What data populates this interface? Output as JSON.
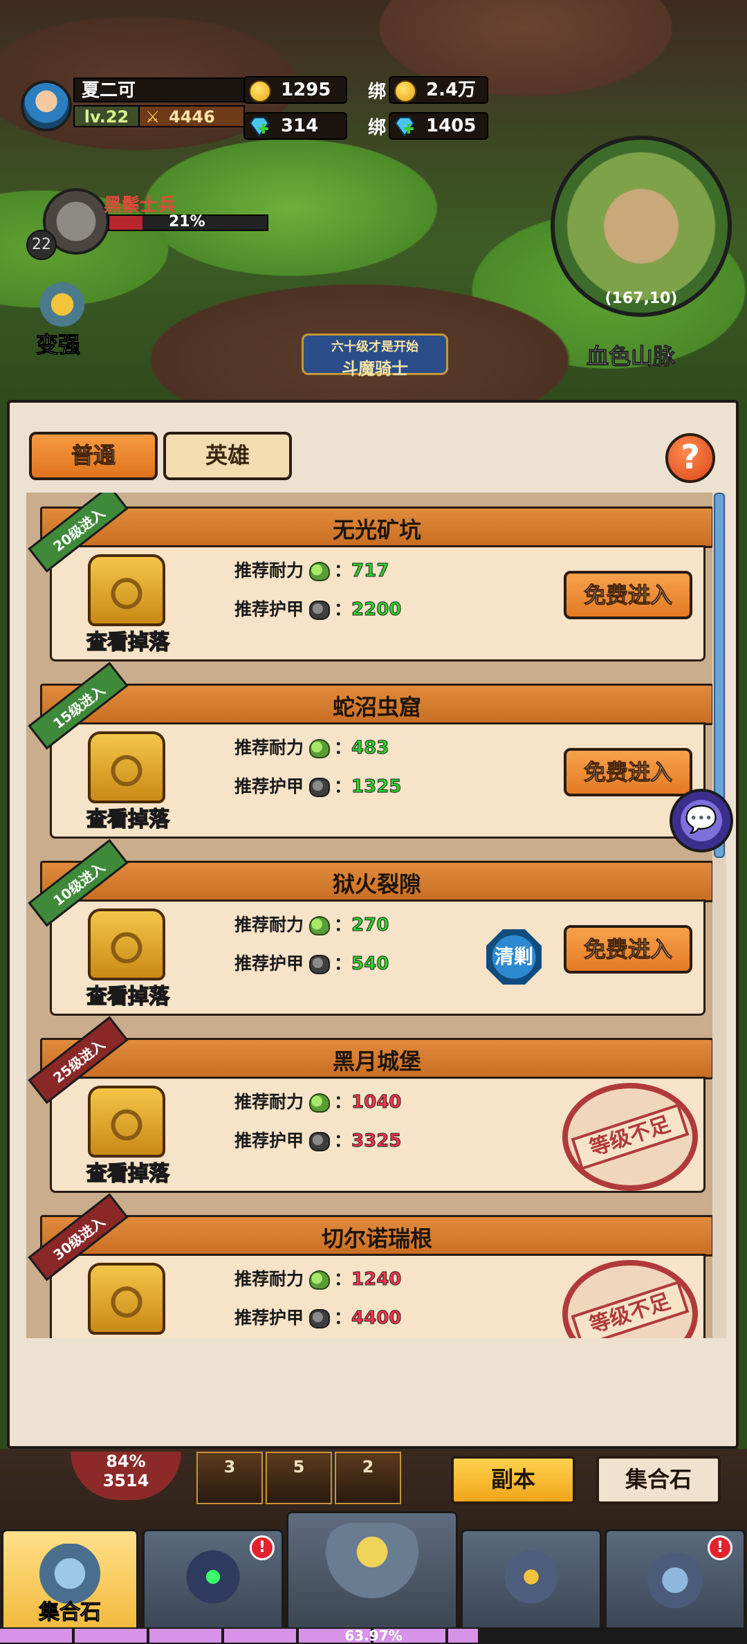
{
  "player": {
    "name": "夏二可",
    "level": "lv.22",
    "power": "4446"
  },
  "currency": {
    "gold": "1295",
    "bound_label_1": "绑",
    "bound_gold": "2.4万",
    "diamond": "314",
    "bound_label_2": "绑",
    "bound_diamond": "1405"
  },
  "enemy": {
    "name": "黑鬃士兵",
    "level": "22",
    "hp_percent": "21%",
    "hp_fraction": 0.21
  },
  "strengthen_label": "变强",
  "quest": {
    "top_text": "六十级才是开始",
    "main_text": "斗魔骑士"
  },
  "minimap": {
    "coords": "(167,10)",
    "region": "血色山脉"
  },
  "tabs": {
    "normal": "普通",
    "hero": "英雄"
  },
  "help_label": "?",
  "stat_labels": {
    "endurance": "推荐耐力",
    "armor": "推荐护甲",
    "colon": "："
  },
  "drop_label": "查看掉落",
  "enter_label": "免费进入",
  "sweep_label": "清剿",
  "locked_label": "等级不足",
  "dungeons": [
    {
      "title": "无光矿坑",
      "ribbon": "20级进入",
      "endurance": "717",
      "armor": "2200",
      "state": "open"
    },
    {
      "title": "蛇沼虫窟",
      "ribbon": "15级进入",
      "endurance": "483",
      "armor": "1325",
      "state": "open"
    },
    {
      "title": "狱火裂隙",
      "ribbon": "10级进入",
      "endurance": "270",
      "armor": "540",
      "state": "open_sweep"
    },
    {
      "title": "黑月城堡",
      "ribbon": "25级进入",
      "endurance": "1040",
      "armor": "3325",
      "state": "locked"
    },
    {
      "title": "切尔诺瑞根",
      "ribbon": "30级进入",
      "endurance": "1240",
      "armor": "4400",
      "state": "locked"
    }
  ],
  "bottom": {
    "hp_percent": "84%",
    "hp_value": "3514",
    "skills": [
      "3",
      "5",
      "2"
    ],
    "sub_dungeon": "副本",
    "sub_stone": "集合石",
    "alert": "!",
    "nav": [
      {
        "label": "集合石"
      }
    ],
    "exp_percent": "63.97%",
    "exp_fraction": 0.6397
  }
}
